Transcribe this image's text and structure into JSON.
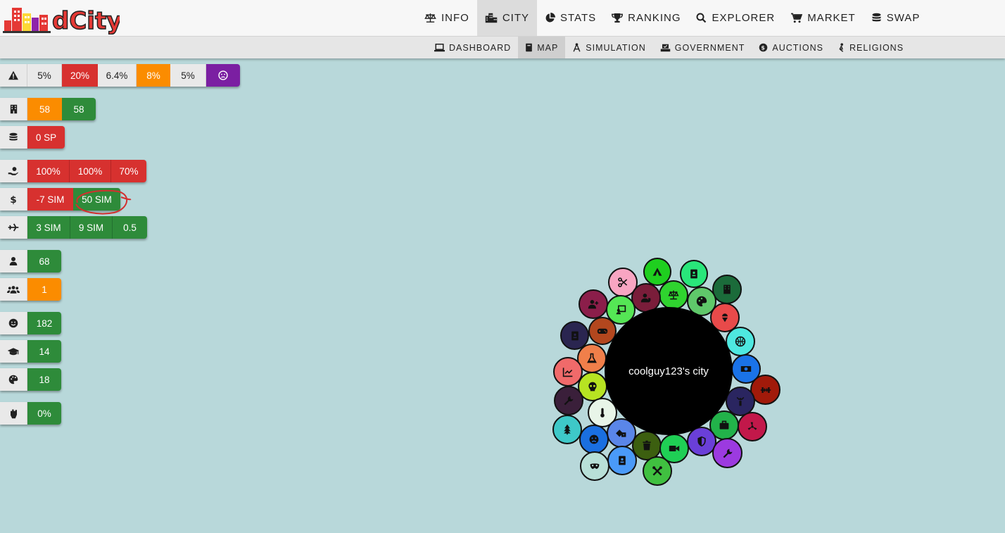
{
  "app": {
    "name": "dCity"
  },
  "nav": {
    "items": [
      {
        "label": "INFO",
        "icon": "balance-icon"
      },
      {
        "label": "CITY",
        "icon": "city-icon",
        "active": true
      },
      {
        "label": "STATS",
        "icon": "pie-chart-icon"
      },
      {
        "label": "RANKING",
        "icon": "trophy-icon"
      },
      {
        "label": "EXPLORER",
        "icon": "search-icon"
      },
      {
        "label": "MARKET",
        "icon": "cart-icon"
      },
      {
        "label": "SWAP",
        "icon": "coins-icon"
      }
    ]
  },
  "subnav": {
    "items": [
      {
        "label": "DASHBOARD",
        "icon": "laptop-icon"
      },
      {
        "label": "MAP",
        "icon": "book-icon",
        "active": true
      },
      {
        "label": "SIMULATION",
        "icon": "compass-icon"
      },
      {
        "label": "GOVERNMENT",
        "icon": "vote-icon"
      },
      {
        "label": "AUCTIONS",
        "icon": "dollar-circle-icon"
      },
      {
        "label": "RELIGIONS",
        "icon": "pray-icon"
      }
    ]
  },
  "stats": {
    "risk": {
      "icon": "warning-icon",
      "values": [
        "5%",
        "20%",
        "6.4%",
        "8%",
        "5%"
      ],
      "colors": [
        "grey",
        "red",
        "grey",
        "orange",
        "grey"
      ],
      "extra_icon": "frown-icon"
    },
    "buildings": {
      "icon": "building-icon",
      "values": [
        "58",
        "58"
      ],
      "colors": [
        "orange",
        "green"
      ]
    },
    "coins": {
      "icon": "coins-icon",
      "values": [
        "0 SP"
      ],
      "colors": [
        "red"
      ]
    },
    "donations": {
      "icon": "hand-coin-icon",
      "values": [
        "100%",
        "100%",
        "70%"
      ],
      "colors": [
        "red",
        "red",
        "red"
      ]
    },
    "income": {
      "icon": "dollar-icon",
      "values": [
        "-7 SIM",
        "50 SIM"
      ],
      "colors": [
        "red",
        "green"
      ]
    },
    "tourism": {
      "icon": "plane-icon",
      "values": [
        "3 SIM",
        "9 SIM",
        "0.5"
      ],
      "colors": [
        "green",
        "green",
        "green"
      ]
    },
    "population": {
      "icon": "user-icon",
      "values": [
        "68"
      ],
      "colors": [
        "green"
      ]
    },
    "unemployed": {
      "icon": "users-icon",
      "values": [
        "1"
      ],
      "colors": [
        "orange"
      ]
    },
    "happiness": {
      "icon": "smile-icon",
      "values": [
        "182"
      ],
      "colors": [
        "green"
      ]
    },
    "education": {
      "icon": "graduation-cap-icon",
      "values": [
        "14"
      ],
      "colors": [
        "green"
      ]
    },
    "culture": {
      "icon": "palette-icon",
      "values": [
        "18"
      ],
      "colors": [
        "green"
      ]
    },
    "crime": {
      "icon": "fist-icon",
      "values": [
        "0%"
      ],
      "colors": [
        "green"
      ]
    }
  },
  "city": {
    "name": "coolguy123's city"
  },
  "colors": {
    "background": "#b8d8da",
    "red": "#d7312f",
    "green": "#2e8b3a",
    "orange": "#fb8c00",
    "purple": "#7b1fa2",
    "annotation": "#d32f2f"
  }
}
